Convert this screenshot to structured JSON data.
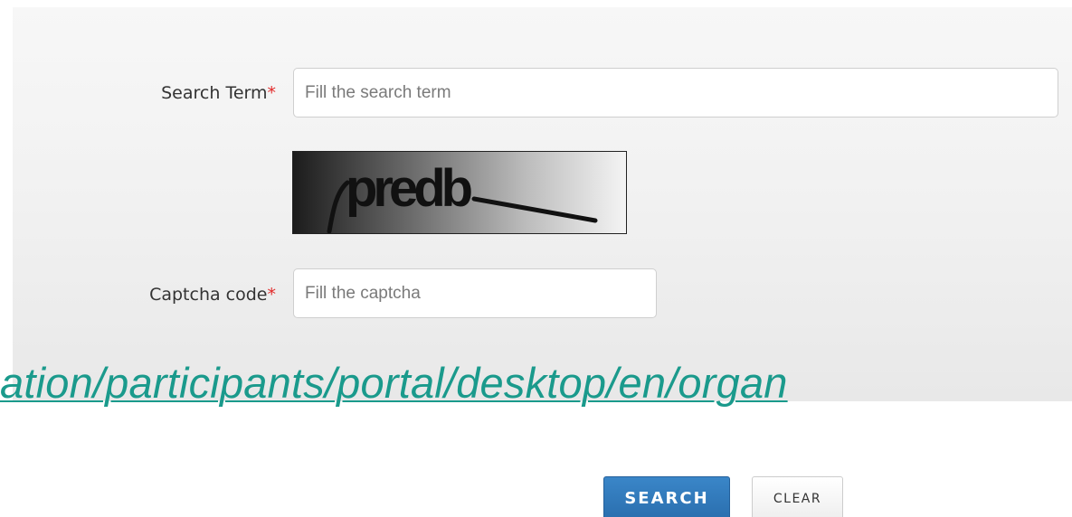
{
  "form": {
    "search_term_label": "Search Term",
    "captcha_label": "Captcha code",
    "required_marker": "*",
    "search_placeholder": "Fill the search term",
    "search_value": "",
    "captcha_placeholder": "Fill the captcha",
    "captcha_value": "",
    "captcha_image_text": "predb"
  },
  "overlay": {
    "url_fragment": "ation/participants/portal/desktop/en/organ"
  },
  "buttons": {
    "search_label": "SEARCH",
    "clear_label": "CLEAR"
  },
  "colors": {
    "required": "#e22b2b",
    "link": "#1a9a8c",
    "primary_button": "#2f78bb"
  }
}
